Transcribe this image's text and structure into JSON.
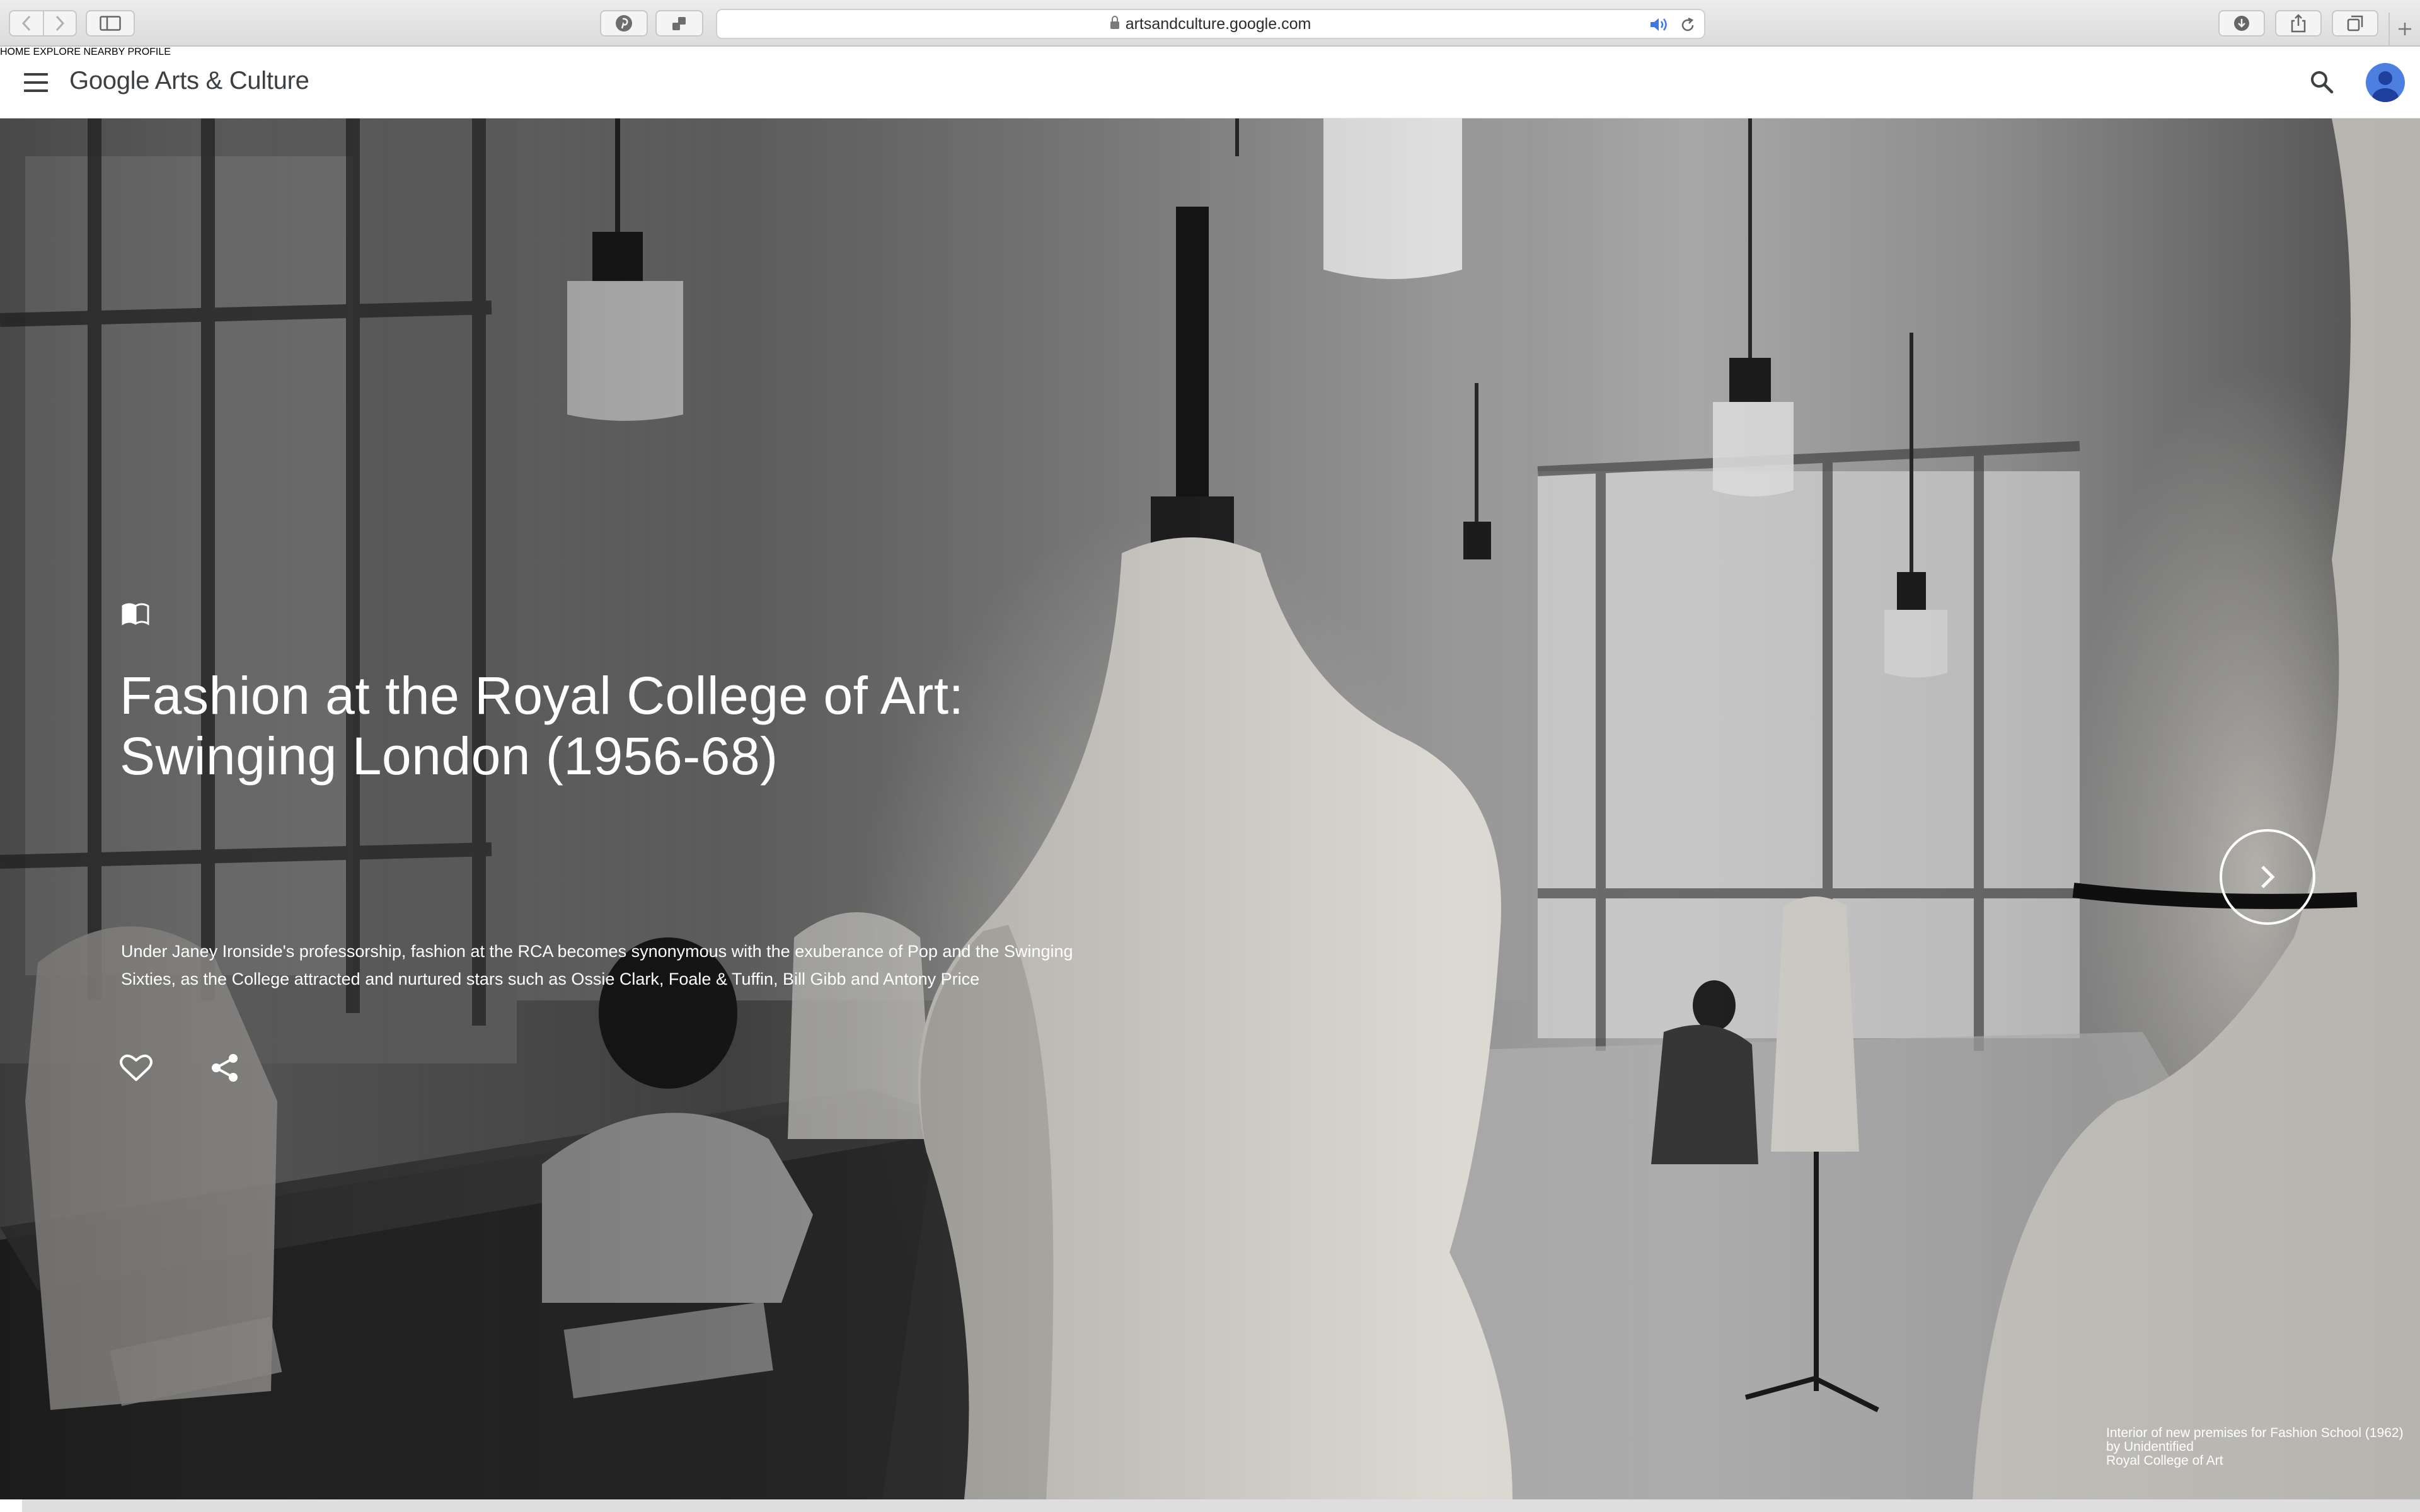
{
  "browser": {
    "url": "artsandculture.google.com"
  },
  "site": {
    "logo": "Google Arts & Culture",
    "nav": [
      {
        "label": "HOME"
      },
      {
        "label": "EXPLORE"
      },
      {
        "label": "NEARBY"
      },
      {
        "label": "PROFILE"
      }
    ]
  },
  "hero": {
    "title_line1": "Fashion at the Royal College of Art:",
    "title_line2": "Swinging London (1956-68)",
    "description_line1": "Under Janey Ironside's professorship, fashion at the RCA becomes synonymous with the exuberance of Pop and the Swinging",
    "description_line2": "Sixties, as the College attracted and nurtured stars such as Ossie Clark, Foale & Tuffin, Bill Gibb and Antony Price",
    "caption": {
      "line1": "Interior of new premises for Fashion School (1962)",
      "line2": "by Unidentified",
      "line3": "Royal College of Art"
    },
    "progress": 0.009
  },
  "icons": {
    "story": "open-book-icon",
    "like": "heart-icon",
    "share": "share-icon",
    "next": "chevron-right-icon",
    "menu": "hamburger-menu-icon",
    "search": "search-icon",
    "avatar": "user-avatar-icon"
  },
  "colors": {
    "accent": "#4d7fe0",
    "text_dark": "#3c4043",
    "hero_text": "#ffffff"
  }
}
